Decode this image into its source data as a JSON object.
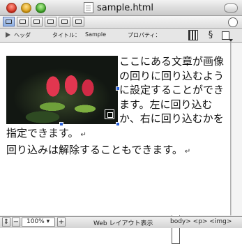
{
  "window": {
    "title": "sample.html"
  },
  "properties_bar": {
    "header_label": "ヘッダ",
    "title_label": "タイトル：",
    "title_value": "Sample",
    "properties_label": "プロパティ："
  },
  "document": {
    "paragraph1": "ここにある文章が画像の回りに回り込むように設定することができます。左に回り込むか、右に回り込むかを指定できます。",
    "paragraph2": "回り込みは解除することもできます。",
    "return_mark": "↵"
  },
  "status_bar": {
    "zoom_minus": "−",
    "zoom_value": "100%",
    "zoom_plus": "+",
    "view_mode": "Web レイアウト表示",
    "breadcrumb": "body> <p> <img>"
  }
}
